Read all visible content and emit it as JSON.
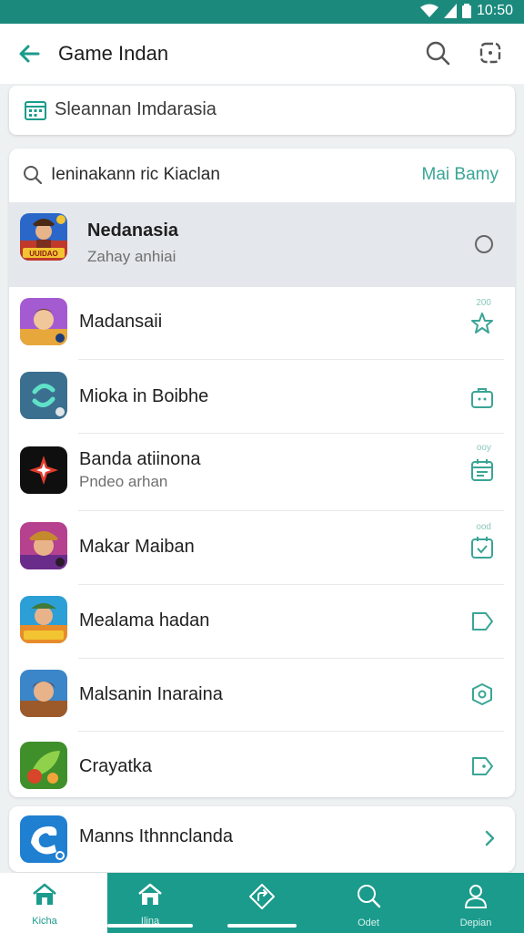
{
  "status": {
    "time": "10:50"
  },
  "header": {
    "title": "Game Indan"
  },
  "subcard": {
    "label": "Sleannan Imdarasia"
  },
  "list_search": {
    "query": "Ieninakann ric Kiaclan",
    "action": "Mai Bamy"
  },
  "apps": [
    {
      "name": "Nedanasia",
      "subtitle": "Zahay anhiai",
      "tiny": "",
      "action_icon": "radio-icon"
    },
    {
      "name": "Madansaii",
      "subtitle": "",
      "tiny": "200",
      "action_icon": "star-icon"
    },
    {
      "name": "Mioka in Boibhe",
      "subtitle": "",
      "tiny": "",
      "action_icon": "bag-icon"
    },
    {
      "name": "Banda atiinona",
      "subtitle": "Pndeo arhan",
      "tiny": "ooy",
      "action_icon": "calendar-icon"
    },
    {
      "name": "Makar Maiban",
      "subtitle": "",
      "tiny": "ood",
      "action_icon": "calendar-check-icon"
    },
    {
      "name": "Mealama hadan",
      "subtitle": "",
      "tiny": "",
      "action_icon": "tag-icon"
    },
    {
      "name": "Malsanin Inaraina",
      "subtitle": "",
      "tiny": "",
      "action_icon": "shield-icon"
    },
    {
      "name": "Crayatka",
      "subtitle": "",
      "tiny": "",
      "action_icon": "label-icon"
    }
  ],
  "featured": {
    "name": "Manns Ithnnclanda"
  },
  "icon_logo_text": "UUIDAO",
  "bottom_nav": [
    {
      "label": "Kicha",
      "icon": "home-icon"
    },
    {
      "label": "Ilina",
      "icon": "home-icon"
    },
    {
      "label": "",
      "icon": "navigate-icon"
    },
    {
      "label": "Odet",
      "icon": "search-icon"
    },
    {
      "label": "Depian",
      "icon": "person-icon"
    }
  ],
  "colors": {
    "accent": "#1a9b8c",
    "accent_dark": "#1b8a7d",
    "selected_row": "#e4e8ec"
  }
}
